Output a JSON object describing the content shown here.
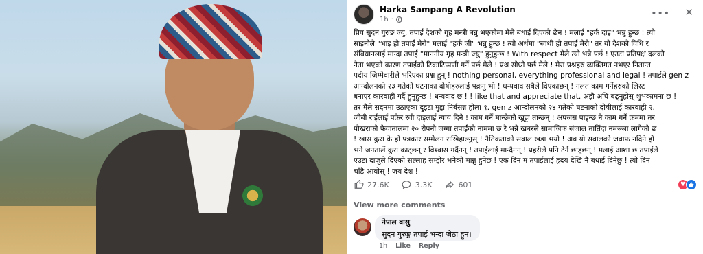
{
  "post": {
    "author": "Harka Sampang A Revolution",
    "time": "1h",
    "more_icon": "more-horizontal-icon",
    "close_icon": "close-icon",
    "lines": [
      "प्रिय सुदन गुरुङ ज्यु, तपाईं देशको गृह मन्त्री बन्नु भएकोमा मैले बधाई दिएको छैन ! मलाई \"हर्क दाइ\" भन्नु हुन्छ ! त्यो",
      "साइनोले \"भाइ हो तपाईं मेरो\" मलाई \"हर्क जी\" भन्नु हुन्छ ! त्यो अर्थमा \"साथी हो तपाईं मेरो\" तर यो देशको विधि र",
      "संविधानलाई मान्दा तपाईं \"माननीय गृह मन्त्री ज्यु\" हुनुहुन्छ ! With respect मैले त्यो भन्नै पर्छ ! एउटा प्रतिपक्ष दलको",
      "नेता भएको कारण तपाईंको टिकाटिप्पणी गर्ने पर्छ मैले ! प्रश्न सोध्ने पर्छ मैले ! मेरा प्रश्नहरु व्यक्तिगत नभएर नितान्त",
      "पदीय जिम्मेवारीले भरिएका प्रश्न हुन् ! nothing personal, everything professional and legal ! तपाईंले gen z",
      "आन्दोलनको २३ गतेको घटनाका दोषीहरुलाई पक्रनु भो ! धन्यवाद सबैले दिएकाछन् ! गलत काम गर्नेहरुको लिस्ट",
      "बनाएर कारवाही गर्दै हुनुहुन्छ ! धन्यवाद छ ! ! like that and appreciate that. अझै अघि बढ्नुहोस् शुभकामना छ !",
      "तर मैले सदनमा उठाएका दुइटा मुद्दा निर्बसन्न होला १. gen z आन्दोलनको २४ गतेको घटनाको दोषीलाई कारवाही २.",
      "जीबी राईलाई पक्रेर रवी दाइलाई न्याय दिने ! काम गर्ने मान्छेको खुट्टा तान्छन् ! अपजस पाइन्छ नै काम गर्ने क्रममा तर",
      "पोखराको फेवातालमा २० रोपनी जग्गा तपाईंको नाममा छ रे भन्ने खबरले सामाजिक संजाल तातिंदा नमज्जा लागेको छ",
      "! खास कुरा के हो पत्रकार सम्मेलन राखिहाल्नुस् ! नैतिकताको सवाल खडा भयो ! अब यो सवालको जवाफ नदिने हो",
      "भने जनतालें कुरा काट्छन् र विश्वास गर्दैनन् ! तपाईंलाई मान्दैनन् ! प्रहरीले पनि टेर्न छाड्छन् ! मलाई आशा छ तपाईंले",
      "एउटा दाजुले दिएको सल्लाह सम्झेर भनेको मान्नु हुनेछ ! एक दिन म तपाईंलाई हृदय देखि नै बधाई दिनेछु ! त्यो दिन",
      "चाँडै आवोस् ! जय देश !"
    ]
  },
  "reactions": {
    "likes": "27.6K",
    "comments": "3.3K",
    "shares": "601",
    "like_icon": "thumbs-up-icon",
    "comment_icon": "comment-icon",
    "share_icon": "share-icon"
  },
  "comments": {
    "view_more": "View more comments",
    "items": [
      {
        "name": "नेपाल वासु",
        "text": "सुदन गुरुङ्ग तपाईं भन्दा जेठा हुन।",
        "time": "1h",
        "like": "Like",
        "reply": "Reply"
      }
    ]
  },
  "colors": {
    "accent": "#1b74e4",
    "love": "#f33e58",
    "muted": "#65676b",
    "comment_bg": "#f0f2f5"
  }
}
